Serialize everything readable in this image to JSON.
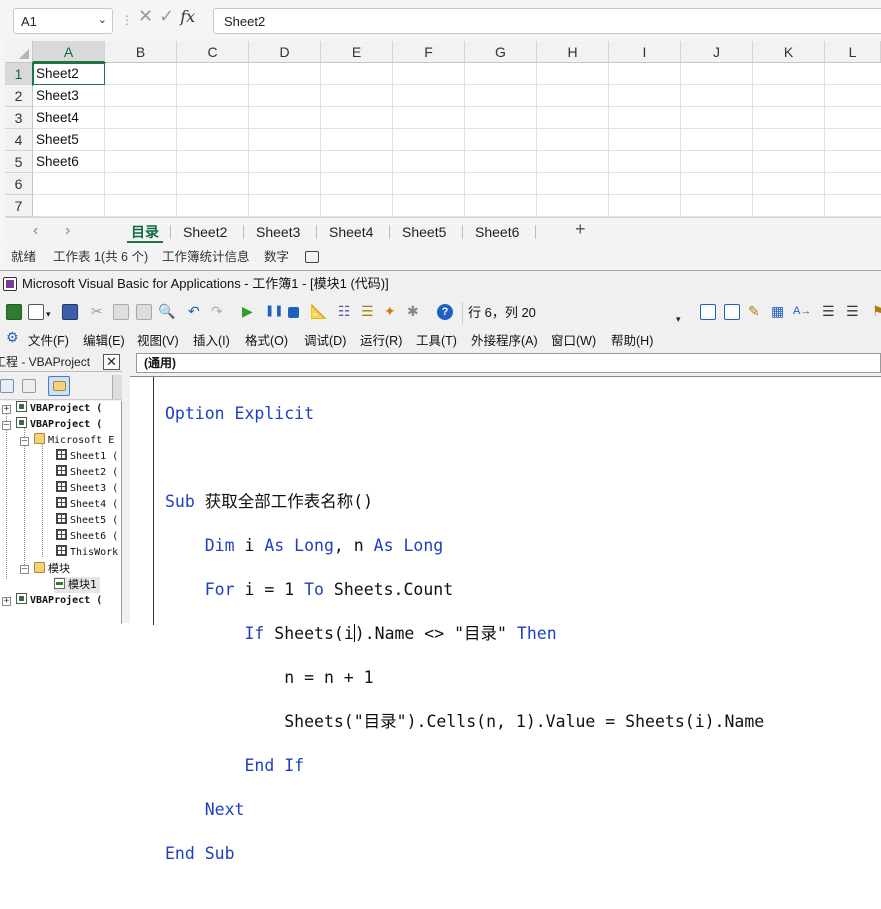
{
  "excel": {
    "name_box": "A1",
    "formula_value": "Sheet2",
    "columns": [
      "A",
      "B",
      "C",
      "D",
      "E",
      "F",
      "G",
      "H",
      "I",
      "J",
      "K",
      "L"
    ],
    "rows": [
      "1",
      "2",
      "3",
      "4",
      "5",
      "6",
      "7"
    ],
    "cells_col_a": [
      "Sheet2",
      "Sheet3",
      "Sheet4",
      "Sheet5",
      "Sheet6",
      "",
      ""
    ],
    "tabs": [
      "目录",
      "Sheet2",
      "Sheet3",
      "Sheet4",
      "Sheet5",
      "Sheet6"
    ],
    "add_tab": "+",
    "status": {
      "ready": "就绪",
      "sheet_info": "工作表 1(共 6 个)",
      "stats": "工作簿统计信息",
      "mode": "数字"
    }
  },
  "vbe": {
    "title": "Microsoft Visual Basic for Applications - 工作簿1 - [模块1 (代码)]",
    "cursor_position": "行 6，列 20",
    "menu": [
      "文件(F)",
      "编辑(E)",
      "视图(V)",
      "插入(I)",
      "格式(O)",
      "调试(D)",
      "运行(R)",
      "工具(T)",
      "外接程序(A)",
      "窗口(W)",
      "帮助(H)"
    ],
    "project_title": "工程 - VBAProject",
    "tree": {
      "vbaproject": "VBAProject (",
      "ms_objects": "Microsoft E",
      "sheets": [
        "Sheet1 (",
        "Sheet2 (",
        "Sheet3 (",
        "Sheet4 (",
        "Sheet5 (",
        "Sheet6 (",
        "ThisWork"
      ],
      "modules_folder": "模块",
      "module1": "模块1"
    },
    "object_combo": "(通用)",
    "code": {
      "l1_kw": "Option Explicit",
      "l3_kw1": "Sub",
      "l3_rest": " 获取全部工作表名称()",
      "l4_a": "    ",
      "l4_kw1": "Dim",
      "l4_b": " i ",
      "l4_kw2": "As Long",
      "l4_c": ", n ",
      "l4_kw3": "As Long",
      "l5_a": "    ",
      "l5_kw1": "For",
      "l5_b": " i = 1 ",
      "l5_kw2": "To",
      "l5_c": " Sheets.Count",
      "l6_a": "        ",
      "l6_kw1": "If",
      "l6_b": " Sheets(i",
      "l6_c": ").Name <> \"目录\" ",
      "l6_kw2": "Then",
      "l7": "            n = n + 1",
      "l8": "            Sheets(\"目录\").Cells(n, 1).Value = Sheets(i).Name",
      "l9_a": "        ",
      "l9_kw": "End If",
      "l10_a": "    ",
      "l10_kw": "Next",
      "l11_kw": "End Sub"
    }
  }
}
